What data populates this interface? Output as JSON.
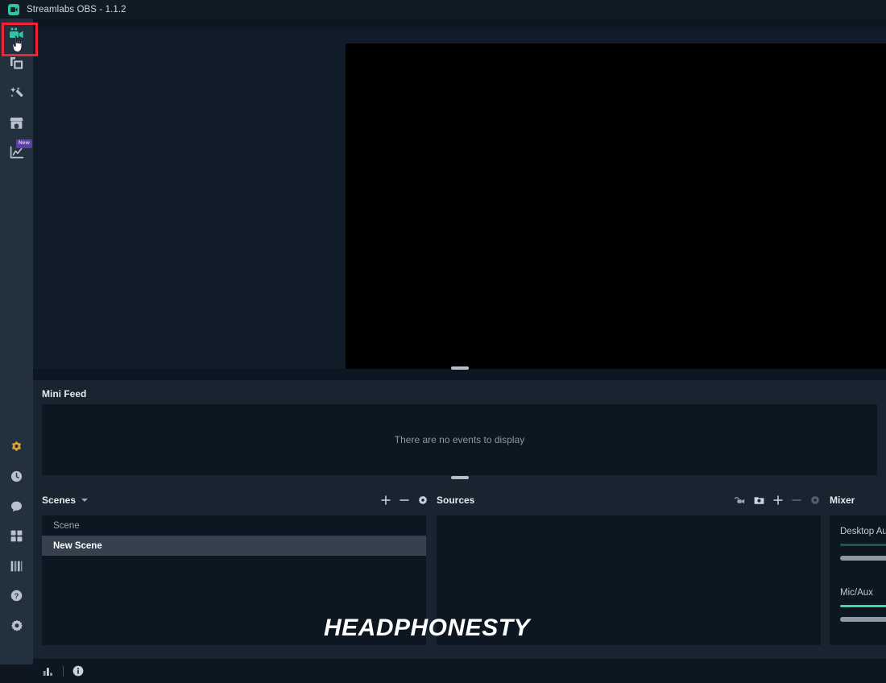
{
  "titlebar": {
    "app_title": "Streamlabs OBS - 1.1.2",
    "logo_icon": "streamlabs-camera-logo",
    "logo_color": "#31c3a2"
  },
  "rail": {
    "top_items": [
      {
        "icon": "video-camera-icon",
        "name": "editor",
        "active": true,
        "color": "#31c3a2"
      },
      {
        "icon": "layers-copy-icon",
        "name": "layout-editor",
        "active": false,
        "color": "#b9c2cb"
      },
      {
        "icon": "magic-wand-icon",
        "name": "themes",
        "active": false,
        "color": "#b9c2cb"
      },
      {
        "icon": "store-icon",
        "name": "store",
        "active": false,
        "color": "#b9c2cb"
      },
      {
        "icon": "chart-line-icon",
        "name": "dashboard-analytics",
        "active": false,
        "color": "#b9c2cb",
        "badge": "New",
        "badge_color": "#5b3ea8"
      }
    ],
    "bottom_items": [
      {
        "icon": "prime-gem-icon",
        "name": "prime",
        "color": "#d8a13a"
      },
      {
        "icon": "clock-icon",
        "name": "activity",
        "color": "#b9c2cb"
      },
      {
        "icon": "chat-bubble-icon",
        "name": "chat",
        "color": "#b9c2cb"
      },
      {
        "icon": "grid-apps-icon",
        "name": "apps",
        "color": "#b9c2cb"
      },
      {
        "icon": "columns-layout-icon",
        "name": "layout",
        "color": "#b9c2cb"
      },
      {
        "icon": "help-circle-icon",
        "name": "help",
        "color": "#b9c2cb"
      },
      {
        "icon": "gear-icon",
        "name": "settings",
        "color": "#b9c2cb"
      }
    ]
  },
  "highlight": {
    "target": "editor-rail-button",
    "color": "#ee2436"
  },
  "cursor": {
    "type": "pointing-hand-cursor"
  },
  "preview": {
    "background_color": "#101c27",
    "canvas_color": "#000000"
  },
  "minifeed": {
    "title": "Mini Feed",
    "empty_message": "There are no events to display"
  },
  "scenes": {
    "title": "Scenes",
    "dropdown_icon": "chevron-down-icon",
    "tools": [
      {
        "icon": "plus-icon",
        "name": "add-scene"
      },
      {
        "icon": "minus-icon",
        "name": "remove-scene"
      },
      {
        "icon": "gear-icon",
        "name": "scene-settings"
      }
    ],
    "items": [
      {
        "label": "Scene",
        "selected": false
      },
      {
        "label": "New Scene",
        "selected": true
      }
    ]
  },
  "sources": {
    "title": "Sources",
    "tools": [
      {
        "icon": "webcam-icon",
        "name": "toggle-source-visibility"
      },
      {
        "icon": "image-folder-icon",
        "name": "open-source-properties"
      },
      {
        "icon": "plus-icon",
        "name": "add-source"
      },
      {
        "icon": "minus-icon",
        "name": "remove-source"
      },
      {
        "icon": "gear-icon",
        "name": "source-settings"
      }
    ],
    "items": []
  },
  "mixer": {
    "title": "Mixer",
    "channels": [
      {
        "label": "Desktop Aud",
        "meter_color": "#1b5b46",
        "meter_level": 100,
        "volume": 92
      },
      {
        "label": "Mic/Aux",
        "meter_color": "#3fd6a8",
        "meter_level": 100,
        "volume": 82
      }
    ]
  },
  "statusbar": {
    "items": [
      {
        "icon": "bar-chart-icon",
        "name": "performance-metrics"
      },
      {
        "icon": "divider",
        "name": "divider"
      },
      {
        "icon": "info-circle-icon",
        "name": "info"
      }
    ]
  },
  "watermark": {
    "text": "HEADPHONESTY"
  }
}
